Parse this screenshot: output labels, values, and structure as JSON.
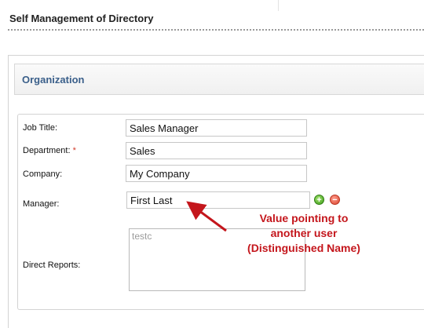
{
  "page": {
    "title": "Self Management of Directory"
  },
  "section": {
    "title": "Organization"
  },
  "form": {
    "job_title": {
      "label": "Job Title:",
      "value": "Sales Manager"
    },
    "department": {
      "label": "Department:",
      "required_mark": "*",
      "value": "Sales"
    },
    "company": {
      "label": "Company:",
      "value": "My Company"
    },
    "manager": {
      "label": "Manager:",
      "value": "First Last",
      "add_icon": "plus-circle-icon",
      "add_glyph": "+",
      "remove_icon": "minus-circle-icon",
      "remove_glyph": "−"
    },
    "direct_reports": {
      "label": "Direct Reports:",
      "items": [
        "testc"
      ]
    }
  },
  "annotation": {
    "line1": "Value pointing to",
    "line2": "another user",
    "line3": "(Distinguished Name)",
    "color": "#c4161c"
  },
  "colors": {
    "section_title": "#3a5f8a",
    "required": "#d23b2a",
    "add": "#3e9d1a",
    "remove": "#d9452f"
  }
}
